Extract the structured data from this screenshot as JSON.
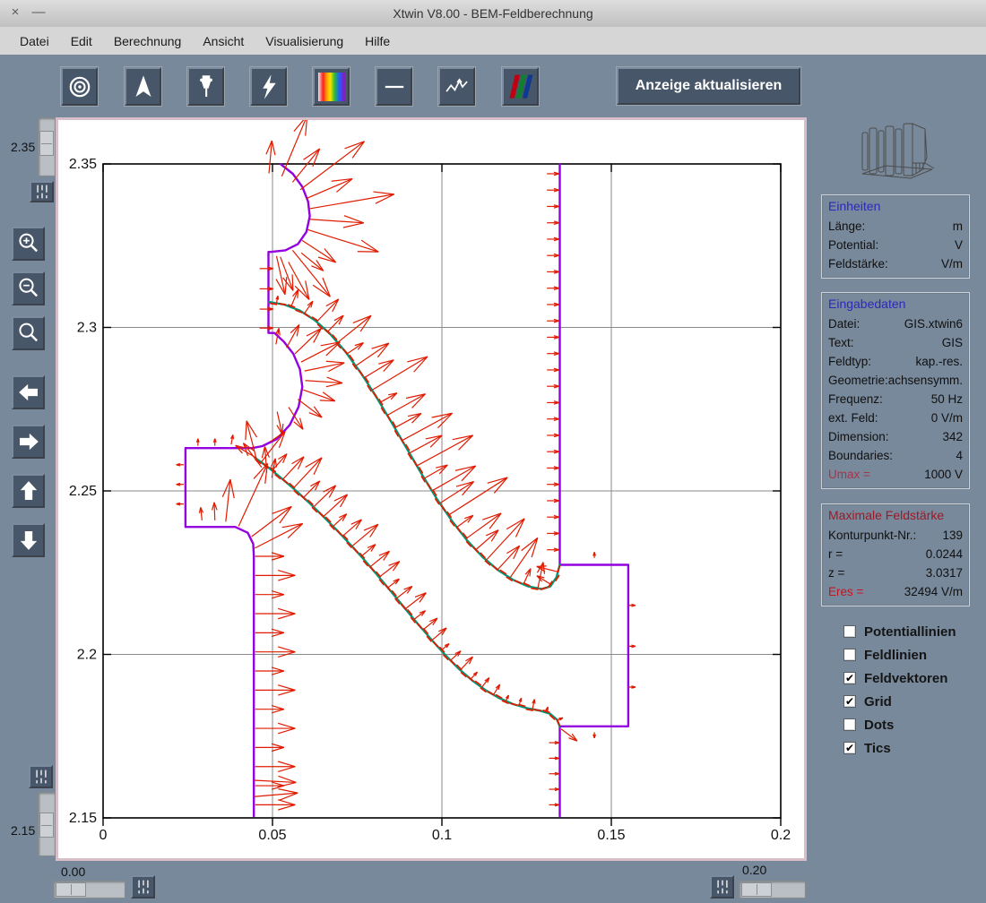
{
  "window": {
    "title": "Xtwin V8.00 - BEM-Feldberechnung",
    "close_glyph": "×",
    "minimize_glyph": "—"
  },
  "menu": {
    "items": [
      "Datei",
      "Edit",
      "Berechnung",
      "Ansicht",
      "Visualisierung",
      "Hilfe"
    ]
  },
  "toolbar": {
    "icons": [
      "target-icon",
      "nav-arrow-icon",
      "pin-icon",
      "lightning-icon",
      "rainbow-icon",
      "line-icon",
      "signal-icon",
      "rgb-stripes-icon"
    ],
    "update_button": "Anzeige aktualisieren"
  },
  "left_rail": {
    "top_slider_label": "2.35",
    "bottom_slider_label": "2.15"
  },
  "bottom_bar": {
    "left_slider_label": "0.00",
    "right_slider_label": "0.20"
  },
  "right_rail": {
    "panels": [
      {
        "title": "Einheiten",
        "title_color": "#2a2ab8",
        "rows": [
          {
            "label": "Länge:",
            "value": "m"
          },
          {
            "label": "Potential:",
            "value": "V"
          },
          {
            "label": "Feldstärke:",
            "value": "V/m"
          }
        ]
      },
      {
        "title": "Eingabedaten",
        "title_color": "#2a2ab8",
        "rows": [
          {
            "label": "Datei:",
            "value": "GIS.xtwin6"
          },
          {
            "label": "Text:",
            "value": "GIS"
          },
          {
            "label": "Feldtyp:",
            "value": "kap.-res."
          },
          {
            "label": "Geometrie:",
            "value": "achsensymm."
          },
          {
            "label": "Frequenz:",
            "value": "50 Hz"
          },
          {
            "label": "ext. Feld:",
            "value": "0 V/m"
          },
          {
            "label": "Dimension:",
            "value": "342"
          },
          {
            "label": "Boundaries:",
            "value": "4"
          },
          {
            "label": "Umax =",
            "value": "1000 V",
            "label_color": "#a83448"
          }
        ]
      },
      {
        "title": "Maximale Feldstärke",
        "title_color": "#a01825",
        "rows": [
          {
            "label": "Konturpunkt-Nr.:",
            "value": "139"
          },
          {
            "label": "r =",
            "value": "0.0244"
          },
          {
            "label": "z =",
            "value": "3.0317"
          },
          {
            "label": "Eres =",
            "value": "32494 V/m",
            "label_color": "#c41422"
          }
        ]
      }
    ],
    "checkboxes": [
      {
        "label": "Potentiallinien",
        "checked": false
      },
      {
        "label": "Feldlinien",
        "checked": false
      },
      {
        "label": "Feldvektoren",
        "checked": true
      },
      {
        "label": "Grid",
        "checked": true
      },
      {
        "label": "Dots",
        "checked": false
      },
      {
        "label": "Tics",
        "checked": true
      }
    ]
  },
  "chart_data": {
    "type": "vector-field",
    "x_range": [
      0,
      0.2
    ],
    "y_range": [
      2.15,
      2.35
    ],
    "x_ticks": [
      {
        "v": 0,
        "label": "0"
      },
      {
        "v": 0.05,
        "label": "0.05"
      },
      {
        "v": 0.1,
        "label": "0.1"
      },
      {
        "v": 0.15,
        "label": "0.15"
      },
      {
        "v": 0.2,
        "label": "0.2"
      }
    ],
    "y_ticks": [
      {
        "v": 2.35,
        "label": "2.35"
      },
      {
        "v": 2.3,
        "label": "2.3"
      },
      {
        "v": 2.25,
        "label": "2.25"
      },
      {
        "v": 2.2,
        "label": "2.2"
      },
      {
        "v": 2.15,
        "label": "2.15"
      }
    ],
    "grid_x": [
      0.05,
      0.1,
      0.15
    ],
    "grid_y": [
      2.2,
      2.25,
      2.3
    ],
    "colors": {
      "electrode": "#9400e0",
      "insulator": "#009977",
      "vector": "#e01b00",
      "grid": "#8a8a8a",
      "frame": "#000000"
    },
    "contours": {
      "electrode_left": [
        [
          0.0525,
          2.3499
        ],
        [
          0.056,
          2.347
        ],
        [
          0.0588,
          2.343
        ],
        [
          0.0605,
          2.3385
        ],
        [
          0.061,
          2.334
        ],
        [
          0.06,
          2.3292
        ],
        [
          0.0575,
          2.3255
        ],
        [
          0.0538,
          2.3236
        ],
        [
          0.0495,
          2.3231
        ],
        [
          0.0488,
          2.3231
        ],
        [
          0.0488,
          2.2983
        ],
        [
          0.0506,
          2.2983
        ],
        [
          0.0533,
          2.2957
        ],
        [
          0.0561,
          2.292
        ],
        [
          0.0581,
          2.2872
        ],
        [
          0.0588,
          2.2818
        ],
        [
          0.0577,
          2.2757
        ],
        [
          0.0551,
          2.2702
        ],
        [
          0.0513,
          2.2659
        ],
        [
          0.047,
          2.2637
        ],
        [
          0.044,
          2.2631
        ],
        [
          0.0243,
          2.2631
        ],
        [
          0.0243,
          2.239
        ],
        [
          0.039,
          2.239
        ],
        [
          0.0427,
          2.2372
        ],
        [
          0.0443,
          2.2338
        ],
        [
          0.0445,
          2.23
        ],
        [
          0.0445,
          2.1505
        ]
      ],
      "electrode_right": [
        [
          0.1348,
          2.3499
        ],
        [
          0.1348,
          2.2274
        ],
        [
          0.155,
          2.2274
        ],
        [
          0.155,
          2.178
        ],
        [
          0.1348,
          2.178
        ],
        [
          0.1348,
          2.1505
        ]
      ],
      "insulator_upper": [
        [
          0.049,
          2.3078
        ],
        [
          0.0535,
          2.307
        ],
        [
          0.058,
          2.3052
        ],
        [
          0.0625,
          2.3022
        ],
        [
          0.067,
          2.298
        ],
        [
          0.0715,
          2.2926
        ],
        [
          0.076,
          2.2862
        ],
        [
          0.0805,
          2.279
        ],
        [
          0.085,
          2.2712
        ],
        [
          0.0895,
          2.2632
        ],
        [
          0.094,
          2.2552
        ],
        [
          0.0985,
          2.2476
        ],
        [
          0.103,
          2.2408
        ],
        [
          0.1075,
          2.2348
        ],
        [
          0.112,
          2.2298
        ],
        [
          0.1165,
          2.2258
        ],
        [
          0.121,
          2.2228
        ],
        [
          0.1255,
          2.2208
        ],
        [
          0.1295,
          2.22
        ],
        [
          0.132,
          2.2208
        ],
        [
          0.1338,
          2.2236
        ],
        [
          0.1348,
          2.2274
        ]
      ],
      "insulator_lower": [
        [
          0.045,
          2.26
        ],
        [
          0.049,
          2.257
        ],
        [
          0.053,
          2.2536
        ],
        [
          0.057,
          2.25
        ],
        [
          0.061,
          2.2462
        ],
        [
          0.065,
          2.2422
        ],
        [
          0.069,
          2.238
        ],
        [
          0.073,
          2.2336
        ],
        [
          0.077,
          2.229
        ],
        [
          0.081,
          2.2242
        ],
        [
          0.085,
          2.2192
        ],
        [
          0.089,
          2.2142
        ],
        [
          0.093,
          2.2092
        ],
        [
          0.097,
          2.2044
        ],
        [
          0.101,
          2.1998
        ],
        [
          0.105,
          2.1956
        ],
        [
          0.109,
          2.192
        ],
        [
          0.113,
          2.189
        ],
        [
          0.117,
          2.1866
        ],
        [
          0.121,
          2.1848
        ],
        [
          0.125,
          2.1836
        ],
        [
          0.129,
          2.1828
        ],
        [
          0.132,
          2.1818
        ],
        [
          0.134,
          2.18
        ],
        [
          0.1348,
          2.178
        ]
      ]
    },
    "arrow_groups": [
      {
        "type": "radial",
        "cx": 0.0478,
        "cy": 2.334,
        "r": 0.0132,
        "angles": [
          85,
          68,
          52,
          38,
          24,
          10,
          -4,
          -18,
          -34,
          -52,
          -70
        ],
        "lengths": [
          0.01,
          0.02,
          0.013,
          0.024,
          0.015,
          0.0255,
          0.016,
          0.022,
          0.012,
          0.018,
          0.011
        ]
      },
      {
        "type": "radial",
        "cx": 0.0492,
        "cy": 2.2845,
        "r": 0.0105,
        "angles": [
          80,
          62,
          45,
          28,
          12,
          -4,
          -20,
          -38,
          -58,
          -78
        ],
        "lengths": [
          0.005,
          0.008,
          0.011,
          0.013,
          0.012,
          0.011,
          0.01,
          0.009,
          0.008,
          0.007
        ]
      },
      {
        "type": "path",
        "path": "insulator_upper",
        "count": 30,
        "side": 1,
        "lengths": [
          0.006,
          0.013,
          0.009,
          0.017,
          0.011,
          0.019,
          0.008,
          0.015,
          0.012,
          0.021
        ],
        "ramp_in": true,
        "ramp_out": true
      },
      {
        "type": "path",
        "path": "insulator_lower",
        "count": 30,
        "side": 1,
        "lengths": [
          0.012,
          0.007,
          0.01,
          0.014,
          0.008,
          0.011
        ],
        "decay": 0.85
      },
      {
        "type": "path_ticks",
        "path": "insulator_upper",
        "count": 50
      },
      {
        "type": "path_ticks",
        "path": "insulator_lower",
        "count": 50
      },
      {
        "type": "vline",
        "x": 0.1348,
        "y_from": 2.347,
        "y_to": 2.232,
        "count": 24,
        "len": 0.0036,
        "tip_on_line": true
      },
      {
        "type": "vline",
        "x": 0.1348,
        "y_from": 2.173,
        "y_to": 2.154,
        "count": 5,
        "len": 0.003,
        "tip_on_line": true
      },
      {
        "type": "vline",
        "x": 0.0445,
        "y_from": 2.23,
        "y_to": 2.154,
        "count": 14,
        "len": [
          0.0085,
          0.0118
        ],
        "tip_on_line": false
      },
      {
        "type": "list",
        "items": [
          [
            0.0512,
            2.3218,
            -78,
            0.012
          ],
          [
            0.0547,
            2.32,
            -62,
            0.013
          ],
          [
            0.0585,
            2.3228,
            -40,
            0.0085
          ],
          [
            0.0462,
            2.318,
            0,
            0.004
          ],
          [
            0.0462,
            2.3118,
            0,
            0.004
          ],
          [
            0.0462,
            2.3056,
            0,
            0.004
          ],
          [
            0.0462,
            2.2998,
            0,
            0.004
          ],
          [
            0.0455,
            2.2588,
            104,
            0.013
          ],
          [
            0.0468,
            2.2572,
            126,
            0.0092
          ],
          [
            0.045,
            2.2602,
            148,
            0.007
          ],
          [
            0.0483,
            2.2556,
            94,
            0.008
          ],
          [
            0.0498,
            2.254,
            80,
            0.006
          ],
          [
            0.04,
            2.2392,
            66,
            0.021
          ],
          [
            0.0362,
            2.2406,
            84,
            0.013
          ],
          [
            0.0438,
            2.236,
            38,
            0.015
          ],
          [
            0.033,
            2.241,
            92,
            0.0055
          ],
          [
            0.0292,
            2.241,
            96,
            0.004
          ],
          [
            0.028,
            2.2638,
            90,
            0.0022
          ],
          [
            0.033,
            2.2638,
            90,
            0.0022
          ],
          [
            0.0378,
            2.2642,
            80,
            0.003
          ],
          [
            0.0238,
            2.258,
            180,
            0.0022
          ],
          [
            0.0238,
            2.252,
            180,
            0.0022
          ],
          [
            0.0238,
            2.246,
            180,
            0.0022
          ],
          [
            0.1553,
            2.215,
            0,
            0.0018
          ],
          [
            0.1553,
            2.2025,
            0,
            0.0018
          ],
          [
            0.1553,
            2.19,
            0,
            0.0018
          ],
          [
            0.145,
            2.2295,
            90,
            0.0018
          ],
          [
            0.145,
            2.1762,
            -90,
            0.0018
          ],
          [
            0.1352,
            2.1772,
            -38,
            0.006
          ],
          [
            0.0448,
            2.2325,
            28,
            0.016
          ],
          [
            0.0445,
            2.1565,
            5,
            0.013
          ],
          [
            0.0445,
            2.1615,
            -3,
            0.0125
          ]
        ]
      }
    ]
  }
}
